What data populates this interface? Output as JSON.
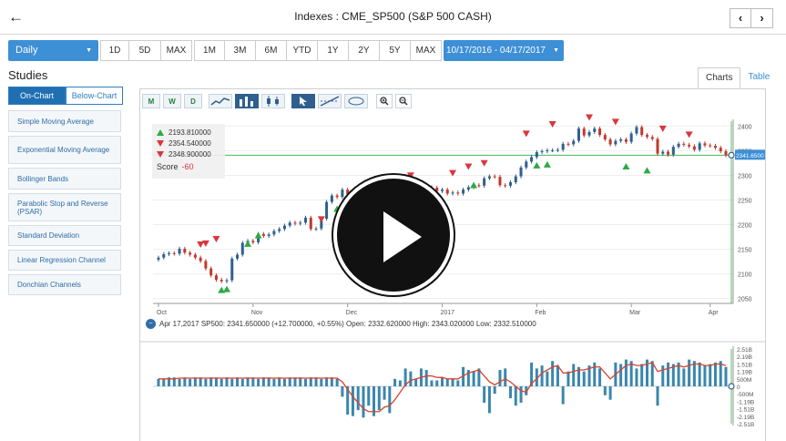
{
  "header": {
    "back_icon": "arrow-left-icon",
    "title": "Indexes : CME_SP500 (S&P 500 CASH)",
    "prev_label": "‹",
    "next_label": "›"
  },
  "range": {
    "period": "Daily",
    "buttons_a": [
      "1D",
      "5D",
      "MAX"
    ],
    "buttons_b": [
      "1M",
      "3M",
      "6M",
      "YTD",
      "1Y",
      "2Y",
      "5Y",
      "MAX"
    ],
    "date_range": "10/17/2016 - 04/17/2017"
  },
  "studies": {
    "title": "Studies",
    "tabs": [
      "On-Chart",
      "Below-Chart"
    ],
    "items": [
      "Simple Moving Average",
      "Exponential Moving Average",
      "Bollinger Bands",
      "Parabolic Stop and Reverse (PSAR)",
      "Standard Deviation",
      "Linear Regression Channel",
      "Donchian Channels"
    ]
  },
  "view_tabs": [
    "Charts",
    "Table"
  ],
  "toolbar": {
    "icons": [
      "signal-m-icon",
      "signal-w-icon",
      "signal-d-icon",
      "line-chart-icon",
      "bar-chart-icon",
      "candlestick-icon",
      "cursor-icon",
      "trendline-icon",
      "measure-icon",
      "zoom-in-icon",
      "zoom-out-icon"
    ],
    "labels": [
      "M",
      "W",
      "D",
      "",
      "",
      "",
      "",
      "",
      "",
      "+",
      "−"
    ]
  },
  "signal_box": {
    "up_value": "2193.810000",
    "down_value_1": "2354.540000",
    "down_value_2": "2348.900000",
    "score_label": "Score",
    "score_value": "-60"
  },
  "info_line": {
    "text": "Apr 17,2017 SP500: 2341.650000 (+12.700000, +0.55%) Open: 2332.620000 High: 2343.020000 Low: 2332.510000"
  },
  "colors": {
    "accent": "#3d8fd6",
    "up": "#2eaa44",
    "down": "#d9363e",
    "candle_up": "#2f5f8f",
    "candle_down": "#c0392b",
    "volume_bar": "#3b86ad",
    "avg_line": "#d9422b",
    "last_price_line": "#2eaa44"
  },
  "chart_data": [
    {
      "type": "candlestick",
      "title": "",
      "x_ticks": [
        "Oct",
        "Nov",
        "Dec",
        "2017",
        "Feb",
        "Mar",
        "Apr"
      ],
      "y_ticks": [
        2050,
        2100,
        2150,
        2200,
        2250,
        2300,
        2350,
        2400
      ],
      "ylim": [
        2040,
        2410
      ],
      "last_price_label": "2341.6500",
      "close": [
        2133,
        2140,
        2142,
        2141,
        2151,
        2143,
        2139,
        2133,
        2126,
        2111,
        2097,
        2088,
        2085,
        2087,
        2131,
        2139,
        2163,
        2167,
        2164,
        2181,
        2177,
        2180,
        2187,
        2191,
        2198,
        2204,
        2202,
        2204,
        2214,
        2191,
        2192,
        2212,
        2246,
        2259,
        2256,
        2271,
        2262,
        2262,
        2253,
        2262,
        2268,
        2264,
        2271,
        2258,
        2263,
        2249,
        2238,
        2239,
        2257,
        2270,
        2269,
        2276,
        2275,
        2268,
        2271,
        2263,
        2265,
        2263,
        2271,
        2276,
        2280,
        2279,
        2294,
        2298,
        2297,
        2280,
        2279,
        2286,
        2298,
        2316,
        2328,
        2337,
        2347,
        2349,
        2351,
        2351,
        2352,
        2364,
        2363,
        2370,
        2395,
        2381,
        2388,
        2395,
        2382,
        2373,
        2363,
        2370,
        2373,
        2368,
        2385,
        2398,
        2382,
        2378,
        2374,
        2344,
        2348,
        2342,
        2358,
        2364,
        2362,
        2359,
        2352,
        2365,
        2361,
        2360,
        2356,
        2349,
        2341
      ],
      "signals_up": [
        2085,
        2087,
        2179,
        2196,
        2250,
        2257,
        2291,
        2277,
        2298,
        2338,
        2340,
        2336,
        2328
      ],
      "signals_down": [
        2140,
        2142,
        2151,
        2191,
        2280,
        2270,
        2285,
        2298,
        2305,
        2365,
        2384,
        2398,
        2389,
        2375,
        2363
      ]
    },
    {
      "type": "bar",
      "title": "",
      "y_ticks": [
        "2.51B",
        "2.19B",
        "1.51B",
        "1.19B",
        "500M",
        "0",
        "-500M",
        "-1.19B",
        "-1.51B",
        "-2.19B",
        "-2.51B"
      ],
      "ylim": [
        -2.51,
        2.51
      ],
      "values": [
        0.5,
        0.5,
        0.6,
        0.6,
        0.5,
        0.6,
        0.5,
        0.6,
        0.6,
        0.5,
        0.6,
        0.6,
        0.5,
        0.6,
        0.5,
        0.6,
        0.5,
        0.6,
        0.6,
        0.5,
        0.6,
        0.6,
        0.5,
        0.6,
        0.5,
        0.6,
        0.6,
        0.6,
        0.5,
        0.6,
        0.6,
        0.5,
        0.6,
        0.6,
        0.5,
        -0.7,
        -1.9,
        -2.0,
        -1.6,
        -2.1,
        -1.3,
        -2.0,
        -1.6,
        -0.9,
        -1.8,
        0.5,
        0.4,
        1.2,
        1.0,
        0.5,
        1.2,
        1.1,
        0.4,
        0.4,
        0.6,
        0.5,
        0.5,
        0.4,
        1.3,
        1.1,
        1.0,
        1.2,
        -1.1,
        -1.8,
        -0.5,
        1.1,
        1.2,
        -0.8,
        -1.3,
        -1.1,
        -0.6,
        1.6,
        1.2,
        1.4,
        1.0,
        1.7,
        1.4,
        -1.2,
        1.0,
        1.5,
        1.3,
        1.0,
        1.4,
        1.6,
        1.2,
        -0.6,
        -0.9,
        1.6,
        1.5,
        1.8,
        1.7,
        1.2,
        1.5,
        1.8,
        1.7,
        -1.3,
        1.4,
        1.6,
        1.5,
        1.6,
        1.2,
        1.8,
        1.7,
        1.6,
        1.4,
        1.5,
        1.6,
        1.7,
        1.3
      ],
      "average": [
        0.5,
        0.5,
        0.5,
        0.5,
        0.55,
        0.55,
        0.55,
        0.55,
        0.55,
        0.55,
        0.55,
        0.55,
        0.55,
        0.55,
        0.55,
        0.55,
        0.55,
        0.55,
        0.55,
        0.55,
        0.55,
        0.55,
        0.55,
        0.55,
        0.55,
        0.55,
        0.55,
        0.55,
        0.55,
        0.55,
        0.55,
        0.55,
        0.55,
        0.55,
        0.55,
        0.3,
        -0.2,
        -0.7,
        -1.1,
        -1.5,
        -1.7,
        -1.7,
        -1.7,
        -1.4,
        -1.3,
        -0.9,
        -0.4,
        0.1,
        0.4,
        0.5,
        0.6,
        0.7,
        0.7,
        0.6,
        0.6,
        0.5,
        0.5,
        0.5,
        0.7,
        0.9,
        1.0,
        1.1,
        0.7,
        0.3,
        0.1,
        0.3,
        0.5,
        0.3,
        0.0,
        -0.3,
        -0.4,
        0.2,
        0.5,
        0.9,
        1.1,
        1.3,
        1.4,
        0.9,
        0.9,
        1.0,
        1.1,
        1.1,
        1.2,
        1.3,
        1.3,
        0.9,
        0.5,
        0.8,
        1.1,
        1.4,
        1.5,
        1.4,
        1.4,
        1.5,
        1.6,
        1.0,
        1.1,
        1.2,
        1.3,
        1.4,
        1.3,
        1.4,
        1.5,
        1.5,
        1.4,
        1.4,
        1.5,
        1.5,
        1.4
      ]
    }
  ]
}
